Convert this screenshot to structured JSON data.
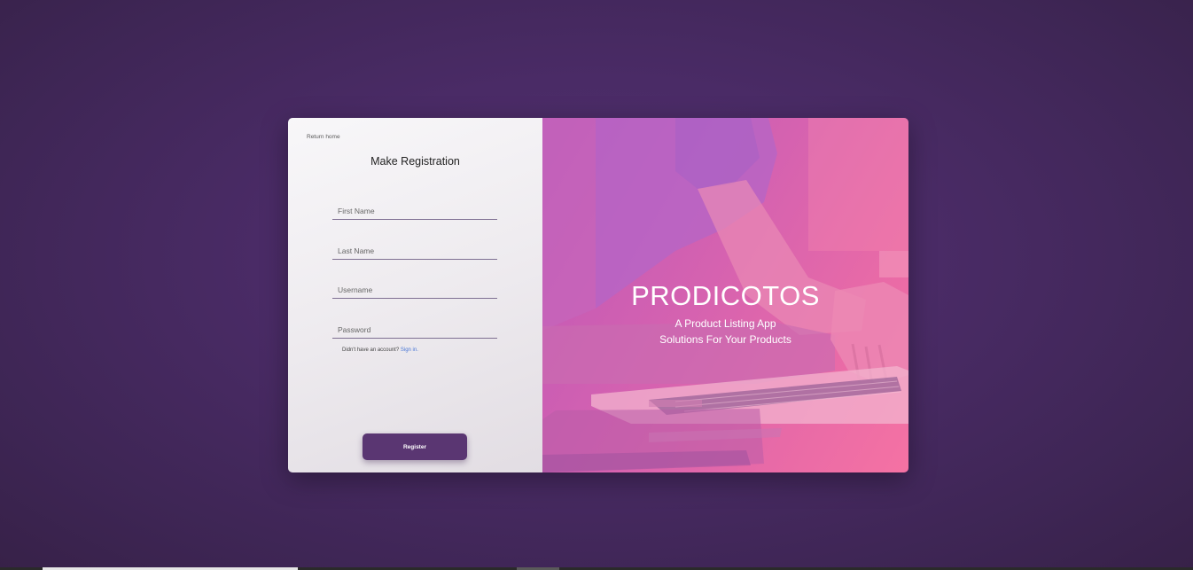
{
  "form": {
    "return_label": "Return home",
    "title": "Make Registration",
    "fields": {
      "first_name_placeholder": "First Name",
      "last_name_placeholder": "Last Name",
      "username_placeholder": "Username",
      "password_placeholder": "Password"
    },
    "account_prompt": "Didn't have an account?",
    "signin_label": "Sign in.",
    "register_label": "Register"
  },
  "hero": {
    "brand": "PRODICOTOS",
    "tagline_1": "A Product Listing App",
    "tagline_2": "Solutions For Your Products",
    "overlay_color": "#e066ad"
  },
  "colors": {
    "background": "#4a2b66",
    "button": "#5a3672",
    "link": "#4b77d6"
  }
}
